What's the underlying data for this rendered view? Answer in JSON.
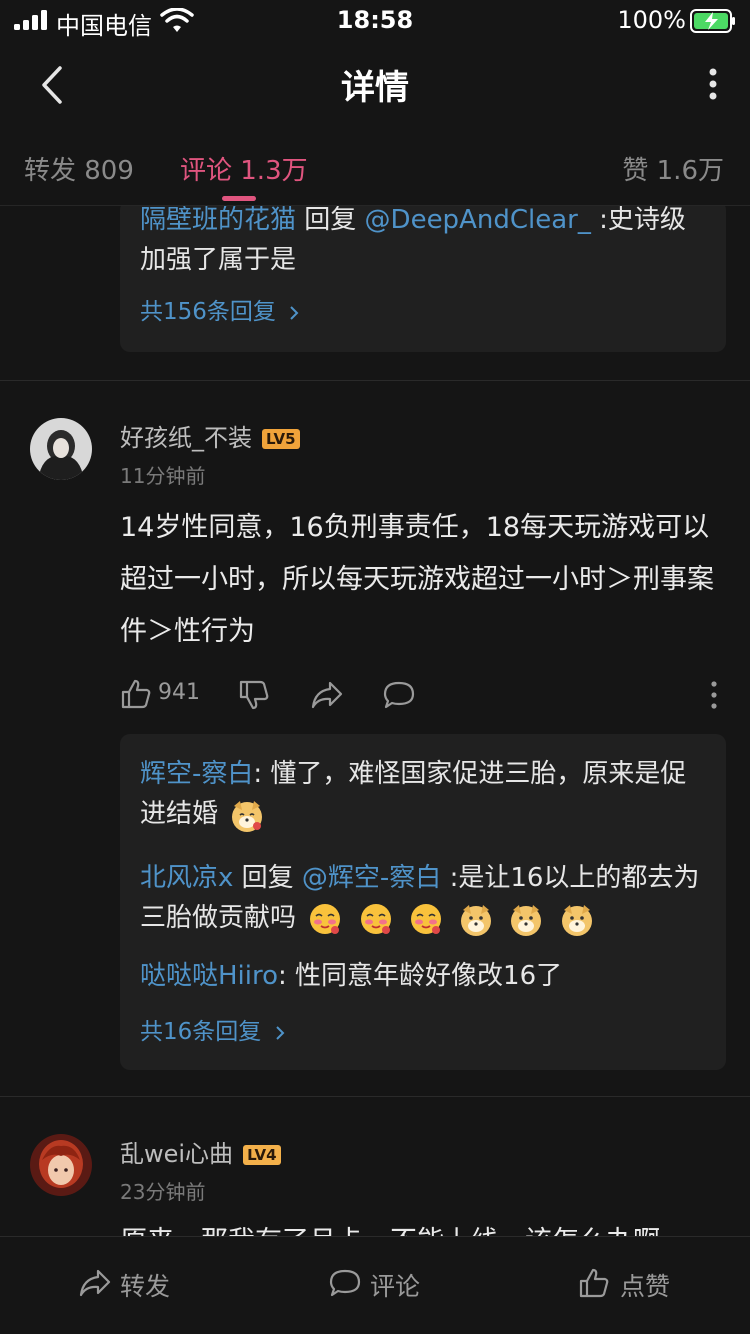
{
  "status_bar": {
    "carrier": "中国电信",
    "time": "18:58",
    "battery": "100%"
  },
  "nav": {
    "title": "详情"
  },
  "tabs": {
    "repost": "转发 809",
    "comment": "评论 1.3万",
    "like": "赞 1.6万"
  },
  "comments": [
    {
      "replies": [
        {
          "user": "隔壁班的花猫",
          "connector": " 回复 ",
          "mention": "@DeepAndClear_",
          "text": " :史诗级加强了属于是"
        }
      ],
      "more_replies": "共156条回复"
    },
    {
      "username": "好孩纸_不装",
      "level": "LV5",
      "time": "11分钟前",
      "text": "14岁性同意，16负刑事责任，18每天玩游戏可以超过一小时，所以每天玩游戏超过一小时＞刑事案件＞性行为",
      "likes": "941",
      "replies": [
        {
          "user": "辉空-察白",
          "text": ": 懂了，难怪国家促进三胎，原来是促进结婚"
        },
        {
          "user": "北风凉x",
          "connector": " 回复 ",
          "mention": "@辉空-察白",
          "text": " :是让16以上的都去为三胎做贡献吗"
        },
        {
          "user": "哒哒哒Hiiro",
          "text": ": 性同意年龄好像改16了"
        }
      ],
      "more_replies": "共16条回复"
    },
    {
      "username": "乱wei心曲",
      "level": "LV4",
      "time": "23分钟前",
      "text": "原来，那我有了月卡，不能上线，该怎么办啊"
    }
  ],
  "bottom_bar": {
    "repost": "转发",
    "comment": "评论",
    "like": "点赞"
  }
}
